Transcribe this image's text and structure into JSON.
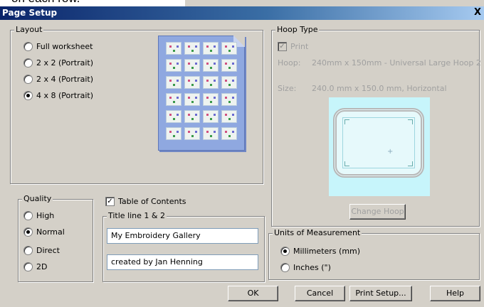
{
  "window": {
    "title": "Page Setup",
    "close_glyph": "X"
  },
  "overlay_text": "on each row.",
  "layout_group": {
    "legend": "Layout",
    "options": [
      "Full worksheet",
      "2 x 2 (Portrait)",
      "2 x 4 (Portrait)",
      "4 x 8 (Portrait)"
    ],
    "selected": "4 x 8 (Portrait)",
    "preview": {
      "columns": 4,
      "rows": 6,
      "icon": "embroidery-thumbnail-icon"
    }
  },
  "quality_group": {
    "legend": "Quality",
    "options": [
      "High",
      "Normal",
      "Direct",
      "2D"
    ],
    "selected": "Normal"
  },
  "contents": {
    "checkbox_label": "Table of Contents",
    "checked": true,
    "titles_legend": "Title line 1 & 2",
    "title_line_1": "My Embroidery Gallery",
    "title_line_2": "created by Jan Henning"
  },
  "hoop_group": {
    "legend": "Hoop Type",
    "print_label": "Print",
    "print_checked": true,
    "print_disabled": true,
    "hoop_label": "Hoop:",
    "hoop_value": "240mm x 150mm - Universal Large Hoop 2",
    "size_label": "Size:",
    "size_value": "240.0 mm x 150.0 mm, Horizontal",
    "change_button": "Change Hoop",
    "preview_bg": "#c7f5fb"
  },
  "units_group": {
    "legend": "Units of Measurement",
    "options": [
      "Millimeters (mm)",
      "Inches (\")"
    ],
    "selected": "Millimeters (mm)"
  },
  "buttons": {
    "ok": "OK",
    "cancel": "Cancel",
    "print_setup": "Print Setup...",
    "help": "Help"
  },
  "colors": {
    "title_bar_start": "#0a246a",
    "title_bar_end": "#a6caf0",
    "dialog_bg": "#d4d0c8"
  }
}
